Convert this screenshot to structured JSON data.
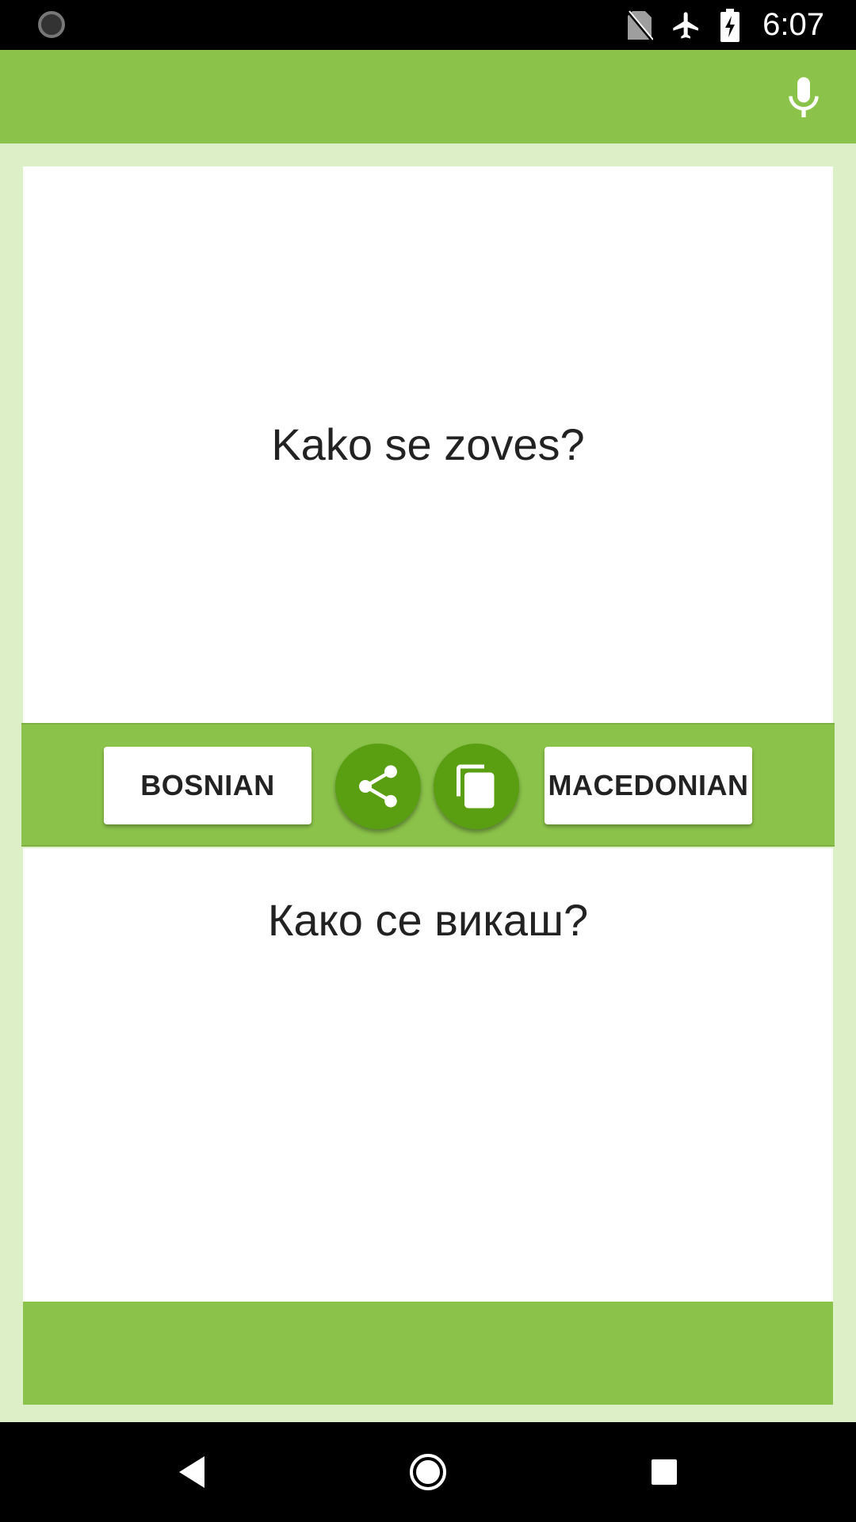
{
  "status_bar": {
    "time": "6:07",
    "icons": [
      "loading-spinner-icon",
      "no-sim-icon",
      "airplane-icon",
      "battery-charging-icon"
    ]
  },
  "app_bar": {
    "mic_icon": "mic-icon",
    "accent_color": "#8bc34a"
  },
  "translation": {
    "source_text": "Kako se zoves?",
    "target_text": "Како се викаш?"
  },
  "toolbar": {
    "source_language": "BOSNIAN",
    "target_language": "MACEDONIAN",
    "share_icon": "share-icon",
    "copy_icon": "copy-icon",
    "button_color": "#5a9f12"
  },
  "nav_bar": {
    "icons": [
      "back-icon",
      "home-icon",
      "recent-apps-icon"
    ]
  }
}
